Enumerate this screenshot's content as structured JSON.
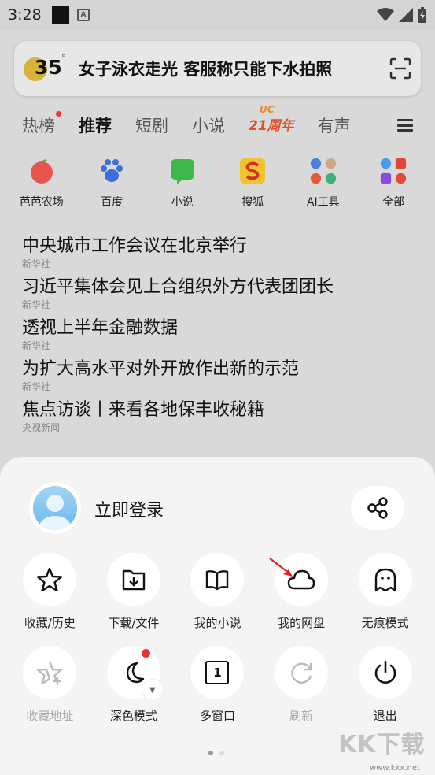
{
  "statusbar": {
    "time": "3:28",
    "notif_letter": "A"
  },
  "search": {
    "temp": "35",
    "deg": "°",
    "headline": "女子泳衣走光 客服称只能下水拍照"
  },
  "tabs": [
    "热榜",
    "推荐",
    "短剧",
    "小说",
    "21周年",
    "有声"
  ],
  "tab_uc": "UC",
  "apps": [
    {
      "label": "芭芭农场",
      "icon": "apple-icon"
    },
    {
      "label": "百度",
      "icon": "paw-icon"
    },
    {
      "label": "小说",
      "icon": "chat-bubble-icon"
    },
    {
      "label": "搜狐",
      "icon": "sohu-icon"
    },
    {
      "label": "AI工具",
      "icon": "ai-tools-icon"
    },
    {
      "label": "全部",
      "icon": "all-apps-icon"
    }
  ],
  "news": [
    {
      "title": "中央城市工作会议在北京举行",
      "source": "新华社"
    },
    {
      "title": "习近平集体会见上合组织外方代表团团长",
      "source": "新华社"
    },
    {
      "title": "透视上半年金融数据",
      "source": "新华社"
    },
    {
      "title": "为扩大高水平对外开放作出新的示范",
      "source": "新华社"
    },
    {
      "title": "焦点访谈丨来看各地保丰收秘籍",
      "source": "央视新闻"
    }
  ],
  "sheet": {
    "login": "立即登录",
    "row1": [
      {
        "label": "收藏/历史",
        "icon": "star-icon"
      },
      {
        "label": "下载/文件",
        "icon": "download-folder-icon"
      },
      {
        "label": "我的小说",
        "icon": "book-icon"
      },
      {
        "label": "我的网盘",
        "icon": "cloud-icon"
      },
      {
        "label": "无痕模式",
        "icon": "ghost-icon"
      }
    ],
    "row2": [
      {
        "label": "收藏地址",
        "icon": "star-plus-icon"
      },
      {
        "label": "深色模式",
        "icon": "moon-icon"
      },
      {
        "label": "多窗口",
        "icon": "window-icon"
      },
      {
        "label": "刷新",
        "icon": "refresh-icon"
      },
      {
        "label": "退出",
        "icon": "power-icon"
      }
    ],
    "window_count": "1"
  },
  "watermark": {
    "text": "KK下载",
    "url": "www.kkx.net"
  }
}
